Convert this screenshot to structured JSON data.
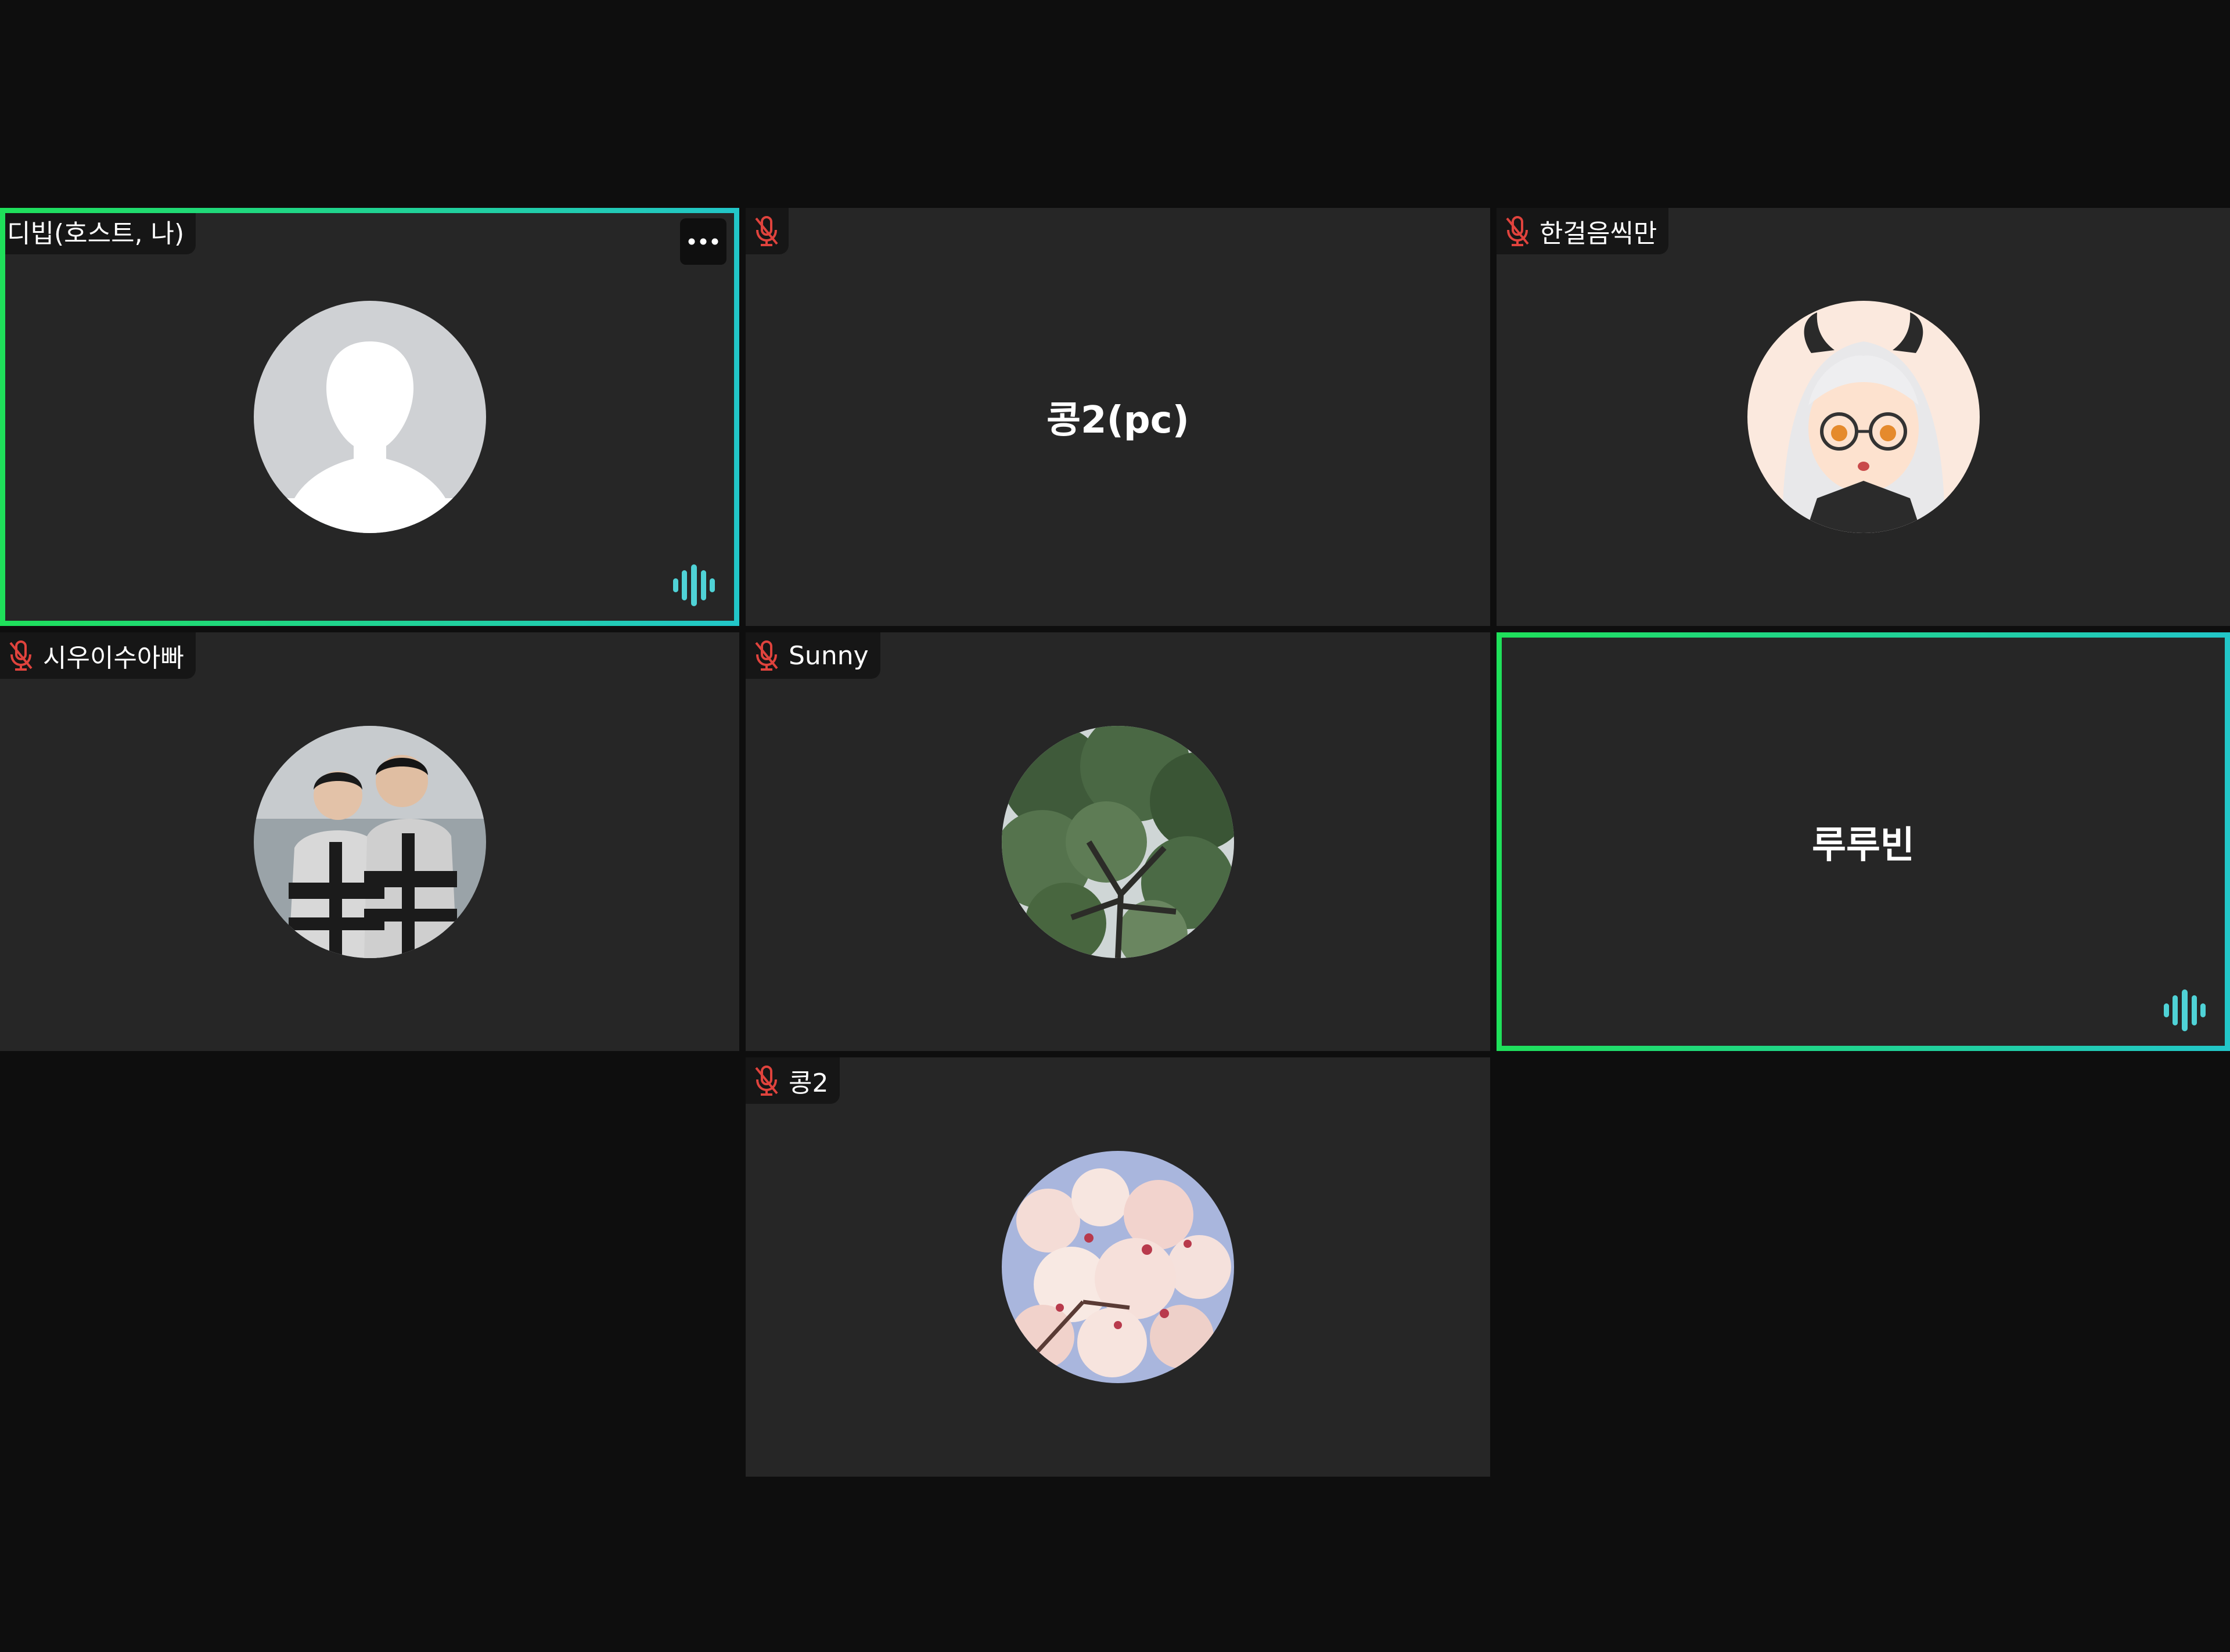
{
  "colors": {
    "background": "#0e0e0e",
    "tile": "#262626",
    "name_tag_bg": "#161616",
    "speaking_green": "#1fe05a",
    "speaking_cyan": "#22c6c9",
    "muted_red": "#e0433d",
    "text": "#ffffff"
  },
  "participants": [
    {
      "name": "디빕(호스트, 나)",
      "muted": false,
      "speaking": true,
      "avatar": "default-person-icon",
      "more_label": "•••"
    },
    {
      "name": "",
      "display_name": "콩2(pc)",
      "muted": true,
      "speaking": false,
      "avatar": "none"
    },
    {
      "name": "한걸음씩만",
      "muted": true,
      "speaking": false,
      "avatar": "anime-character-photo"
    },
    {
      "name": "시우이수아빠",
      "muted": true,
      "speaking": false,
      "avatar": "two-people-photo"
    },
    {
      "name": "Sunny",
      "muted": true,
      "speaking": false,
      "avatar": "tree-canopy-photo"
    },
    {
      "name": "",
      "display_name": "루루빈",
      "muted": false,
      "speaking": true,
      "avatar": "none"
    },
    {
      "name": "콩2",
      "muted": true,
      "speaking": false,
      "avatar": "cherry-blossom-photo"
    }
  ]
}
